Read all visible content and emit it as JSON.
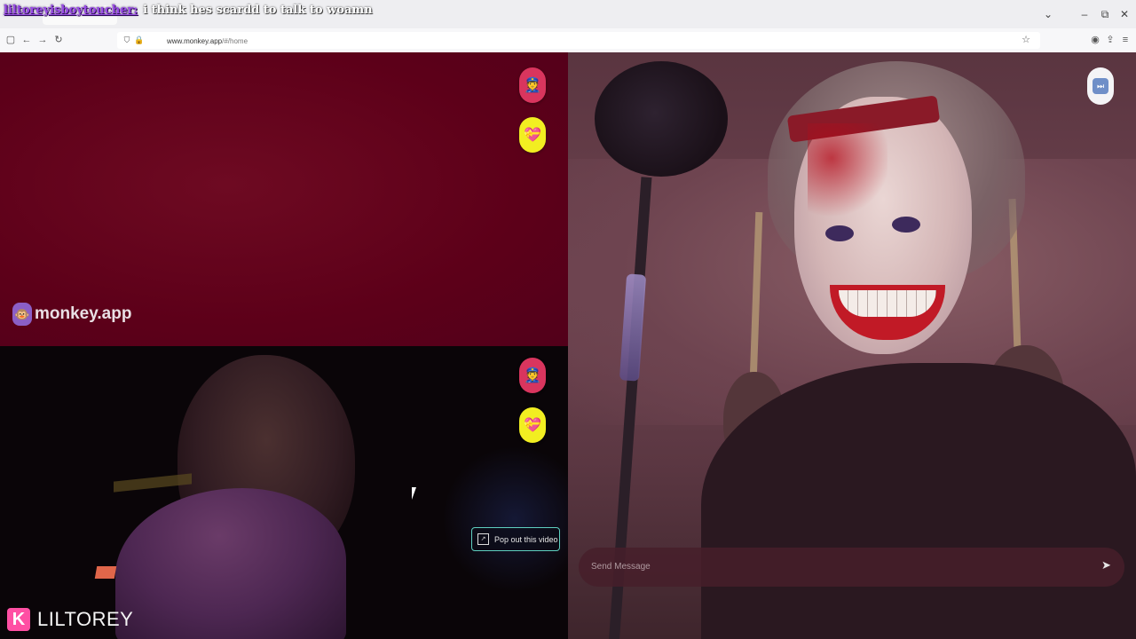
{
  "chat_overlay": {
    "username": "liltoreyisboytoucher:",
    "message": "i think hes scardd to talk to woamn"
  },
  "browser": {
    "url_host": "www.monkey.app",
    "url_path": "/#/home",
    "window_buttons": {
      "dropdown": "⌄",
      "minimize": "–",
      "restore": "⧉",
      "close": "✕"
    },
    "nav_icons": {
      "sidebar": "▢",
      "back": "←",
      "forward": "→",
      "reload": "↻",
      "star": "☆",
      "menu": "≡"
    }
  },
  "left_top_panel": {
    "brand_name": "monkey.app",
    "brand_icon": "monkey-icon",
    "police_button_icon": "police-officer-emoji",
    "heart_button_icon": "heart-emoji"
  },
  "left_bottom_panel": {
    "popout_label": "Pop out this video"
  },
  "right_panel": {
    "message_placeholder": "Send Message",
    "skip_icon": "fast-forward-icon"
  },
  "watermark": {
    "logo_letter": "K",
    "text": "LILTOREY"
  },
  "colors": {
    "accent_pink": "#d9355e",
    "accent_yellow": "#f2ee21",
    "popout_border": "#5fd0c0",
    "brand_purple": "#8b5fc6",
    "watermark_pink": "#ff4fa3"
  }
}
